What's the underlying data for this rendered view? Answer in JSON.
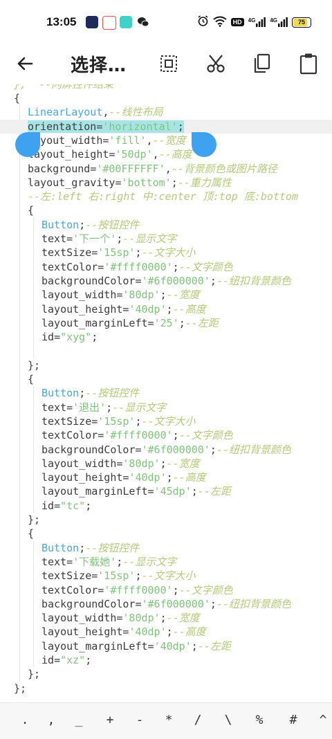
{
  "status_bar": {
    "time": "13:05",
    "battery": "75",
    "signal_labels": [
      "HD",
      "4G",
      "4G"
    ],
    "icons": [
      "alarm-icon",
      "wifi-icon",
      "hd-icon",
      "signal-icon",
      "signal-icon",
      "battery-icon"
    ],
    "app_icons": [
      "app-icon",
      "app-icon",
      "app-icon",
      "wechat-icon"
    ]
  },
  "action_bar": {
    "title": "选择…",
    "back_icon": "back-arrow-icon",
    "actions": [
      "select-all-icon",
      "cut-icon",
      "copy-icon",
      "paste-icon"
    ]
  },
  "editor": {
    "top_partial": "},  --闪屏控件结束",
    "lines": [
      {
        "indent": 0,
        "tokens": [
          [
            "pl",
            "{"
          ]
        ]
      },
      {
        "indent": 1,
        "tokens": [
          [
            "kw",
            "LinearLayout"
          ],
          [
            "pl",
            ","
          ],
          [
            "cm",
            "--线性布局"
          ]
        ]
      },
      {
        "indent": 1,
        "sel": true,
        "tokens": [
          [
            "id",
            "orientation"
          ],
          [
            "pl",
            "="
          ],
          [
            "str",
            "'horizontal'"
          ],
          [
            "pl",
            ";"
          ]
        ]
      },
      {
        "indent": 1,
        "tokens": [
          [
            "id",
            "layout_width"
          ],
          [
            "pl",
            "="
          ],
          [
            "str",
            "'fill'"
          ],
          [
            "pl",
            ","
          ],
          [
            "cm",
            "--宽度"
          ]
        ]
      },
      {
        "indent": 1,
        "tokens": [
          [
            "id",
            "layout_height"
          ],
          [
            "pl",
            "="
          ],
          [
            "str",
            "'50dp'"
          ],
          [
            "pl",
            ","
          ],
          [
            "cm",
            "--高度"
          ]
        ]
      },
      {
        "indent": 1,
        "tokens": [
          [
            "id",
            "background"
          ],
          [
            "pl",
            "="
          ],
          [
            "str",
            "'#00FFFFFF'"
          ],
          [
            "pl",
            ","
          ],
          [
            "cm",
            "--背景颜色或图片路径"
          ]
        ]
      },
      {
        "indent": 1,
        "tokens": [
          [
            "id",
            "layout_gravity"
          ],
          [
            "pl",
            "="
          ],
          [
            "str",
            "'bottom'"
          ],
          [
            "pl",
            ";"
          ],
          [
            "cm",
            "--重力属性"
          ]
        ]
      },
      {
        "indent": 1,
        "tokens": [
          [
            "cm",
            "--左:left 右:right 中:center 顶:top 底:bottom"
          ]
        ]
      },
      {
        "indent": 1,
        "tokens": [
          [
            "pl",
            "{"
          ]
        ]
      },
      {
        "indent": 2,
        "tokens": [
          [
            "kw",
            "Button"
          ],
          [
            "pl",
            ";"
          ],
          [
            "cm",
            "--按钮控件"
          ]
        ]
      },
      {
        "indent": 2,
        "tokens": [
          [
            "id",
            "text"
          ],
          [
            "pl",
            "="
          ],
          [
            "str",
            "'下一个'"
          ],
          [
            "pl",
            ";"
          ],
          [
            "cm",
            "--显示文字"
          ]
        ]
      },
      {
        "indent": 2,
        "tokens": [
          [
            "id",
            "textSize"
          ],
          [
            "pl",
            "="
          ],
          [
            "str",
            "'15sp'"
          ],
          [
            "pl",
            ";"
          ],
          [
            "cm",
            "--文字大小"
          ]
        ]
      },
      {
        "indent": 2,
        "tokens": [
          [
            "id",
            "textColor"
          ],
          [
            "pl",
            "="
          ],
          [
            "str",
            "'#ffff0000'"
          ],
          [
            "pl",
            ";"
          ],
          [
            "cm",
            "--文字颜色"
          ]
        ]
      },
      {
        "indent": 2,
        "tokens": [
          [
            "id",
            "backgroundColor"
          ],
          [
            "pl",
            "="
          ],
          [
            "str",
            "'#6f000000'"
          ],
          [
            "pl",
            ";"
          ],
          [
            "cm",
            "--纽扣背景颜色"
          ]
        ]
      },
      {
        "indent": 2,
        "tokens": [
          [
            "id",
            "layout_width"
          ],
          [
            "pl",
            "="
          ],
          [
            "str",
            "'80dp'"
          ],
          [
            "pl",
            ";"
          ],
          [
            "cm",
            "--宽度"
          ]
        ]
      },
      {
        "indent": 2,
        "tokens": [
          [
            "id",
            "layout_height"
          ],
          [
            "pl",
            "="
          ],
          [
            "str",
            "'40dp'"
          ],
          [
            "pl",
            ";"
          ],
          [
            "cm",
            "--高度"
          ]
        ]
      },
      {
        "indent": 2,
        "tokens": [
          [
            "id",
            "layout_marginLeft"
          ],
          [
            "pl",
            "="
          ],
          [
            "str",
            "'25'"
          ],
          [
            "pl",
            ";"
          ],
          [
            "cm",
            "--左距"
          ]
        ]
      },
      {
        "indent": 2,
        "tokens": [
          [
            "id",
            "id"
          ],
          [
            "pl",
            "="
          ],
          [
            "str",
            "\"xyg\""
          ],
          [
            "pl",
            ";"
          ]
        ]
      },
      {
        "indent": 2,
        "tokens": []
      },
      {
        "indent": 1,
        "tokens": [
          [
            "pl",
            "};"
          ]
        ]
      },
      {
        "indent": 1,
        "tokens": [
          [
            "pl",
            "{"
          ]
        ]
      },
      {
        "indent": 2,
        "tokens": [
          [
            "kw",
            "Button"
          ],
          [
            "pl",
            ";"
          ],
          [
            "cm",
            "--按钮控件"
          ]
        ]
      },
      {
        "indent": 2,
        "tokens": [
          [
            "id",
            "text"
          ],
          [
            "pl",
            "="
          ],
          [
            "str",
            "'退出'"
          ],
          [
            "pl",
            ";"
          ],
          [
            "cm",
            "--显示文字"
          ]
        ]
      },
      {
        "indent": 2,
        "tokens": [
          [
            "id",
            "textSize"
          ],
          [
            "pl",
            "="
          ],
          [
            "str",
            "'15sp'"
          ],
          [
            "pl",
            ";"
          ],
          [
            "cm",
            "--文字大小"
          ]
        ]
      },
      {
        "indent": 2,
        "tokens": [
          [
            "id",
            "textColor"
          ],
          [
            "pl",
            "="
          ],
          [
            "str",
            "'#ffff0000'"
          ],
          [
            "pl",
            ";"
          ],
          [
            "cm",
            "--文字颜色"
          ]
        ]
      },
      {
        "indent": 2,
        "tokens": [
          [
            "id",
            "backgroundColor"
          ],
          [
            "pl",
            "="
          ],
          [
            "str",
            "'#6f000000'"
          ],
          [
            "pl",
            ";"
          ],
          [
            "cm",
            "--纽扣背景颜色"
          ]
        ]
      },
      {
        "indent": 2,
        "tokens": [
          [
            "id",
            "layout_width"
          ],
          [
            "pl",
            "="
          ],
          [
            "str",
            "'80dp'"
          ],
          [
            "pl",
            ";"
          ],
          [
            "cm",
            "--宽度"
          ]
        ]
      },
      {
        "indent": 2,
        "tokens": [
          [
            "id",
            "layout_height"
          ],
          [
            "pl",
            "="
          ],
          [
            "str",
            "'40dp'"
          ],
          [
            "pl",
            ";"
          ],
          [
            "cm",
            "--高度"
          ]
        ]
      },
      {
        "indent": 2,
        "tokens": [
          [
            "id",
            "layout_marginLeft"
          ],
          [
            "pl",
            "="
          ],
          [
            "str",
            "'45dp'"
          ],
          [
            "pl",
            ";"
          ],
          [
            "cm",
            "--左距"
          ]
        ]
      },
      {
        "indent": 2,
        "tokens": [
          [
            "id",
            "id"
          ],
          [
            "pl",
            "="
          ],
          [
            "str",
            "\"tc\""
          ],
          [
            "pl",
            ";"
          ]
        ]
      },
      {
        "indent": 1,
        "tokens": [
          [
            "pl",
            "};"
          ]
        ]
      },
      {
        "indent": 1,
        "tokens": [
          [
            "pl",
            "{"
          ]
        ]
      },
      {
        "indent": 2,
        "tokens": [
          [
            "kw",
            "Button"
          ],
          [
            "pl",
            ";"
          ],
          [
            "cm",
            "--按钮控件"
          ]
        ]
      },
      {
        "indent": 2,
        "tokens": [
          [
            "id",
            "text"
          ],
          [
            "pl",
            "="
          ],
          [
            "str",
            "'下载她'"
          ],
          [
            "pl",
            ";"
          ],
          [
            "cm",
            "--显示文字"
          ]
        ]
      },
      {
        "indent": 2,
        "tokens": [
          [
            "id",
            "textSize"
          ],
          [
            "pl",
            "="
          ],
          [
            "str",
            "'15sp'"
          ],
          [
            "pl",
            ";"
          ],
          [
            "cm",
            "--文字大小"
          ]
        ]
      },
      {
        "indent": 2,
        "tokens": [
          [
            "id",
            "textColor"
          ],
          [
            "pl",
            "="
          ],
          [
            "str",
            "'#ffff0000'"
          ],
          [
            "pl",
            ";"
          ],
          [
            "cm",
            "--文字颜色"
          ]
        ]
      },
      {
        "indent": 2,
        "tokens": [
          [
            "id",
            "backgroundColor"
          ],
          [
            "pl",
            "="
          ],
          [
            "str",
            "'#6f000000'"
          ],
          [
            "pl",
            ";"
          ],
          [
            "cm",
            "--纽扣背景颜色"
          ]
        ]
      },
      {
        "indent": 2,
        "tokens": [
          [
            "id",
            "layout_width"
          ],
          [
            "pl",
            "="
          ],
          [
            "str",
            "'80dp'"
          ],
          [
            "pl",
            ";"
          ],
          [
            "cm",
            "--宽度"
          ]
        ]
      },
      {
        "indent": 2,
        "tokens": [
          [
            "id",
            "layout_height"
          ],
          [
            "pl",
            "="
          ],
          [
            "str",
            "'40dp'"
          ],
          [
            "pl",
            ";"
          ],
          [
            "cm",
            "--高度"
          ]
        ]
      },
      {
        "indent": 2,
        "tokens": [
          [
            "id",
            "layout_marginLeft"
          ],
          [
            "pl",
            "="
          ],
          [
            "str",
            "'40dp'"
          ],
          [
            "pl",
            ";"
          ],
          [
            "cm",
            "--左距"
          ]
        ]
      },
      {
        "indent": 2,
        "tokens": [
          [
            "id",
            "id"
          ],
          [
            "pl",
            "="
          ],
          [
            "str",
            "\"xz\""
          ],
          [
            "pl",
            ";"
          ]
        ]
      },
      {
        "indent": 1,
        "tokens": [
          [
            "pl",
            "};"
          ]
        ]
      },
      {
        "indent": 0,
        "tokens": [
          [
            "pl",
            "};"
          ]
        ]
      }
    ]
  },
  "symbols": [
    ".",
    ",",
    "_",
    "+",
    "-",
    "*",
    "/",
    "\\",
    "%",
    "#",
    "^"
  ],
  "colors": {
    "keyword": "#4aa7d8",
    "string": "#7fc47a",
    "comment": "#b5c97b",
    "selection": "#a8e4e6",
    "handle": "#3fa2f0"
  }
}
